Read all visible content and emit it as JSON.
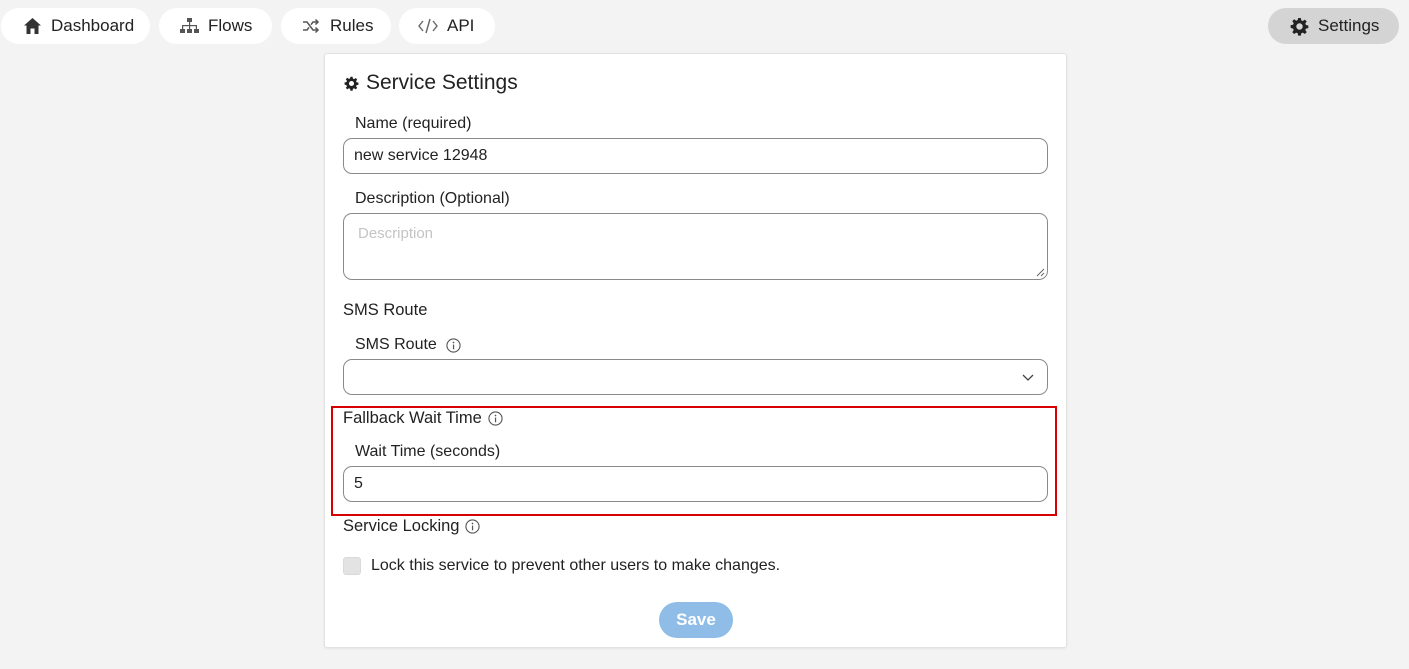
{
  "nav": {
    "items": [
      {
        "label": "Dashboard",
        "icon": "home-icon"
      },
      {
        "label": "Flows",
        "icon": "sitemap-icon"
      },
      {
        "label": "Rules",
        "icon": "shuffle-icon"
      },
      {
        "label": "API",
        "icon": "code-icon"
      }
    ],
    "settings": {
      "label": "Settings",
      "icon": "gear-icon"
    }
  },
  "card": {
    "title": "Service Settings",
    "name_label": "Name (required)",
    "name_value": "new service 12948",
    "description_label": "Description (Optional)",
    "description_placeholder": "Description",
    "sms_section": "SMS Route",
    "sms_label": "SMS Route",
    "sms_value": "",
    "fallback_section": "Fallback Wait Time",
    "wait_label": "Wait Time (seconds)",
    "wait_value": "5",
    "locking_section": "Service Locking",
    "lock_checkbox_label": "Lock this service to prevent other users to make changes.",
    "lock_checked": false,
    "save_label": "Save"
  },
  "colors": {
    "highlight": "#d60000",
    "save_button": "#8fbde8",
    "active_nav": "#d4d4d4"
  }
}
